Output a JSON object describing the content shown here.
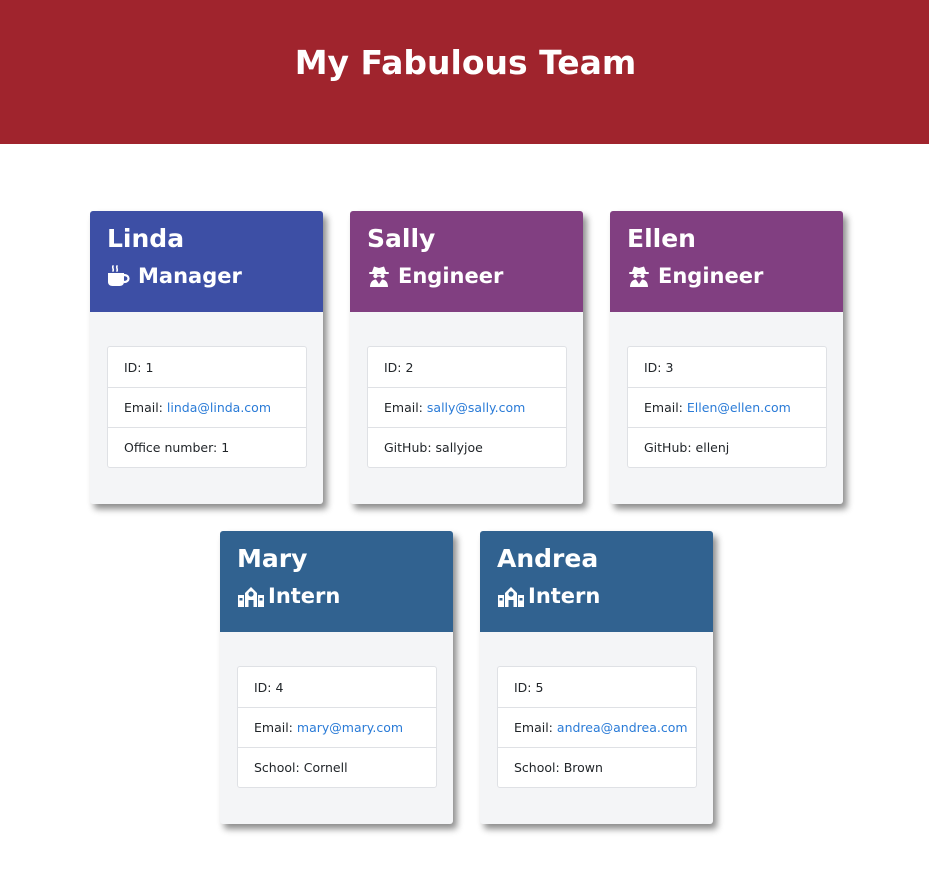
{
  "header": {
    "title": "My Fabulous Team"
  },
  "colors": {
    "header": "#a0242d",
    "manager": "#3d4fa5",
    "engineer": "#813f81",
    "intern": "#316290",
    "link": "#2a7bd7"
  },
  "employees": [
    {
      "name": "Linda",
      "role": "Manager",
      "icon": "coffee-icon",
      "id_label": "ID:",
      "id": "1",
      "email_label": "Email:",
      "email": "linda@linda.com",
      "extra_label": "Office number:",
      "extra": "1"
    },
    {
      "name": "Sally",
      "role": "Engineer",
      "icon": "user-secret-icon",
      "id_label": "ID:",
      "id": "2",
      "email_label": "Email:",
      "email": "sally@sally.com",
      "extra_label": "GitHub:",
      "extra": "sallyjoe"
    },
    {
      "name": "Ellen",
      "role": "Engineer",
      "icon": "user-secret-icon",
      "id_label": "ID:",
      "id": "3",
      "email_label": "Email:",
      "email": "Ellen@ellen.com",
      "extra_label": "GitHub:",
      "extra": "ellenj"
    },
    {
      "name": "Mary",
      "role": "Intern",
      "icon": "school-icon",
      "id_label": "ID:",
      "id": "4",
      "email_label": "Email:",
      "email": "mary@mary.com",
      "extra_label": "School:",
      "extra": "Cornell"
    },
    {
      "name": "Andrea",
      "role": "Intern",
      "icon": "school-icon",
      "id_label": "ID:",
      "id": "5",
      "email_label": "Email:",
      "email": "andrea@andrea.com",
      "extra_label": "School:",
      "extra": "Brown"
    }
  ]
}
